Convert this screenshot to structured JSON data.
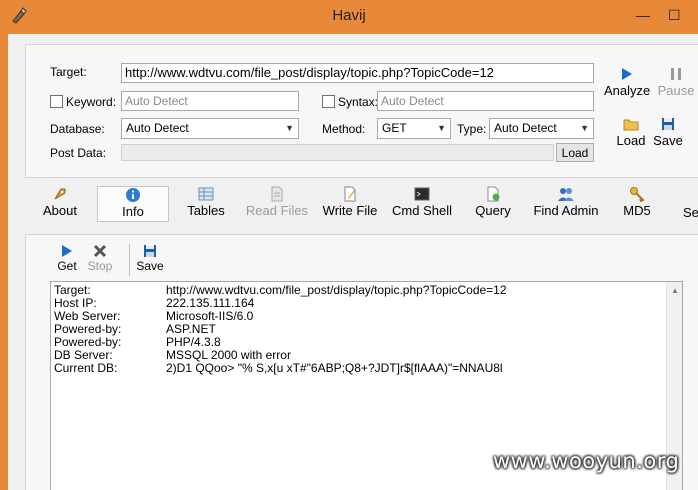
{
  "window": {
    "title": "Havij"
  },
  "form": {
    "target_label": "Target:",
    "target_value": "http://www.wdtvu.com/file_post/display/topic.php?TopicCode=12",
    "keyword_label": "Keyword:",
    "keyword_placeholder": "Auto Detect",
    "syntax_label": "Syntax:",
    "syntax_placeholder": "Auto Detect",
    "database_label": "Database:",
    "database_value": "Auto Detect",
    "method_label": "Method:",
    "method_value": "GET",
    "type_label": "Type:",
    "type_value": "Auto Detect",
    "postdata_label": "Post Data:",
    "load_button": "Load"
  },
  "actions": {
    "analyze": "Analyze",
    "pause": "Pause",
    "load": "Load",
    "save": "Save"
  },
  "tabs": [
    {
      "label": "About",
      "icon": "rocket-icon"
    },
    {
      "label": "Info",
      "icon": "info-icon"
    },
    {
      "label": "Tables",
      "icon": "table-icon"
    },
    {
      "label": "Read Files",
      "icon": "document-icon"
    },
    {
      "label": "Write File",
      "icon": "write-file-icon"
    },
    {
      "label": "Cmd Shell",
      "icon": "terminal-icon"
    },
    {
      "label": "Query",
      "icon": "query-icon"
    },
    {
      "label": "Find Admin",
      "icon": "users-icon"
    },
    {
      "label": "MD5",
      "icon": "key-icon"
    },
    {
      "label": "Se",
      "icon": ""
    }
  ],
  "info_toolbar": {
    "get": "Get",
    "stop": "Stop",
    "save": "Save"
  },
  "info_output": [
    {
      "key": "Target:",
      "value": "http://www.wdtvu.com/file_post/display/topic.php?TopicCode=12"
    },
    {
      "key": "Host IP:",
      "value": "222.135.111.164"
    },
    {
      "key": "Web Server:",
      "value": "Microsoft-IIS/6.0"
    },
    {
      "key": "Powered-by:",
      "value": "ASP.NET"
    },
    {
      "key": "Powered-by:",
      "value": "PHP/4.3.8"
    },
    {
      "key": "DB Server:",
      "value": "MSSQL 2000 with error"
    },
    {
      "key": "Current DB:",
      "value": "2)D1 QQoo>  \"% S,x[u xT#\"6ABP;Q8+?JDT]r$[flAAA)\"=NNAU8l"
    }
  ],
  "watermark": "www.wooyun.org",
  "colors": {
    "titlebar": "#e8893a",
    "accent_blue": "#1b6fc9"
  }
}
